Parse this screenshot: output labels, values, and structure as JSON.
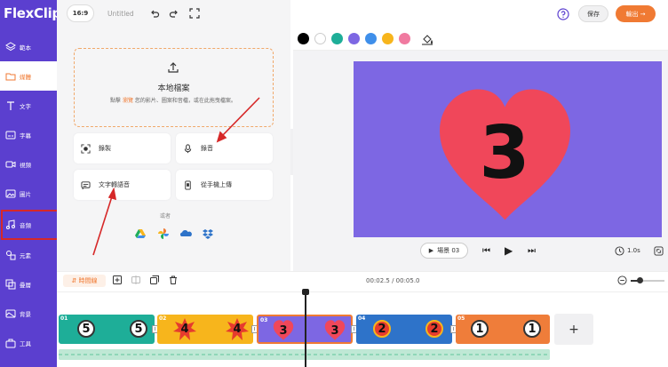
{
  "app": {
    "logo_text": "FlexClip",
    "ratio": "16:9",
    "title": "Untitled"
  },
  "sidebar": {
    "items": [
      {
        "label": "範本",
        "icon": "layers-icon"
      },
      {
        "label": "媒體",
        "icon": "folder-icon",
        "active": true
      },
      {
        "label": "文字",
        "icon": "text-icon"
      },
      {
        "label": "字幕",
        "icon": "subtitle-icon"
      },
      {
        "label": "視頻",
        "icon": "video-icon"
      },
      {
        "label": "圖片",
        "icon": "image-icon"
      },
      {
        "label": "音頻",
        "icon": "music-icon"
      },
      {
        "label": "元素",
        "icon": "shapes-icon"
      },
      {
        "label": "疊層",
        "icon": "overlay-icon"
      },
      {
        "label": "背景",
        "icon": "background-icon"
      },
      {
        "label": "工具",
        "icon": "toolbox-icon"
      }
    ]
  },
  "media_panel": {
    "upload_title": "本地檔案",
    "upload_desc_pre": "點擊",
    "upload_desc_link": "瀏覽",
    "upload_desc_post": "您的影片、圖案和音檔，或在此拖曳檔案。",
    "cards": [
      {
        "label": "錄製",
        "icon": "record-icon"
      },
      {
        "label": "錄音",
        "icon": "microphone-icon"
      },
      {
        "label": "文字轉語音",
        "icon": "text-to-speech-icon"
      },
      {
        "label": "從手機上傳",
        "icon": "phone-icon"
      }
    ],
    "or_text": "或者",
    "cloud_sources": [
      "google-drive-icon",
      "google-photos-icon",
      "onedrive-icon",
      "dropbox-icon"
    ]
  },
  "header_right": {
    "save_label": "保存",
    "export_label": "輸出"
  },
  "colors": {
    "brand": "#5b3fcf",
    "accent": "#f07a33",
    "swatches": [
      "#000000",
      "#ffffff",
      "#1eae98",
      "#7d67e3",
      "#3f8fea",
      "#f7b51c",
      "#f07aa0"
    ],
    "canvas_bg": "#7d67e3",
    "heart": "#f0475a"
  },
  "preview": {
    "canvas_number": "3",
    "scene_label": "場景 03",
    "duration": "1.0s"
  },
  "timeline": {
    "toggle_label": "時間線",
    "time_readout": "00:02.5 / 00:05.0",
    "clips": [
      {
        "index": "01",
        "number": "5",
        "color": "#1eae98"
      },
      {
        "index": "02",
        "number": "4",
        "color": "#f7b51c"
      },
      {
        "index": "03",
        "number": "3",
        "color": "#7d67e3",
        "selected": true
      },
      {
        "index": "04",
        "number": "2",
        "color": "#2e73c9"
      },
      {
        "index": "05",
        "number": "1",
        "color": "#ef7d3a"
      }
    ],
    "add_label": "+"
  }
}
